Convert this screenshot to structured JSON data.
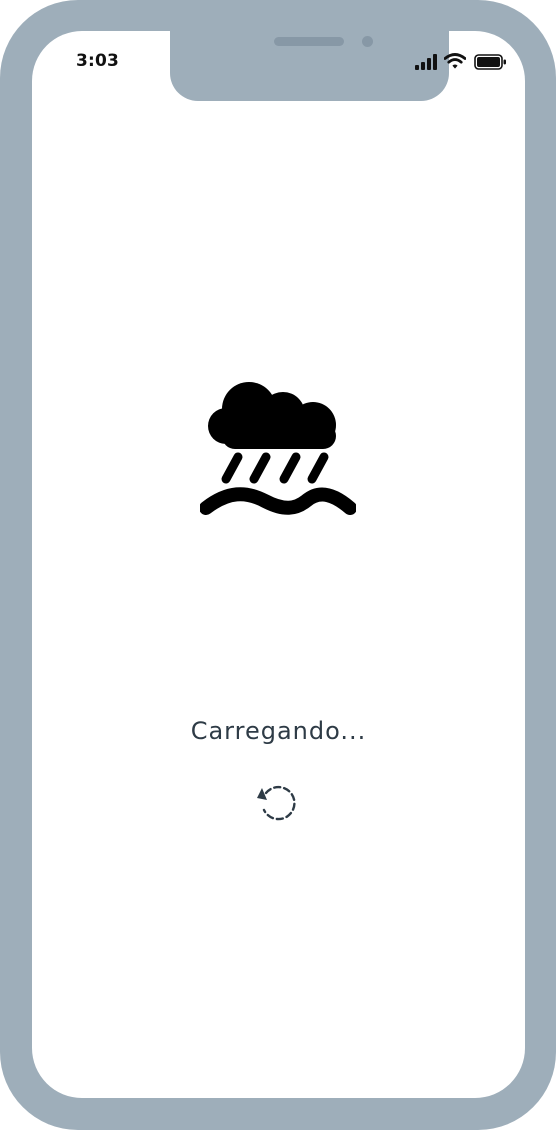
{
  "status_bar": {
    "time": "3:03",
    "icons": [
      "cellular-signal-icon",
      "wifi-icon",
      "battery-icon"
    ]
  },
  "app": {
    "icon": "cloud-rain-flood-icon",
    "loading_text": "Carregando...",
    "spinner_icon": "refresh-spinner-icon"
  },
  "colors": {
    "frame": "#9eaeba",
    "screen": "#ffffff",
    "text": "#2e3b46",
    "icon": "#000000"
  }
}
